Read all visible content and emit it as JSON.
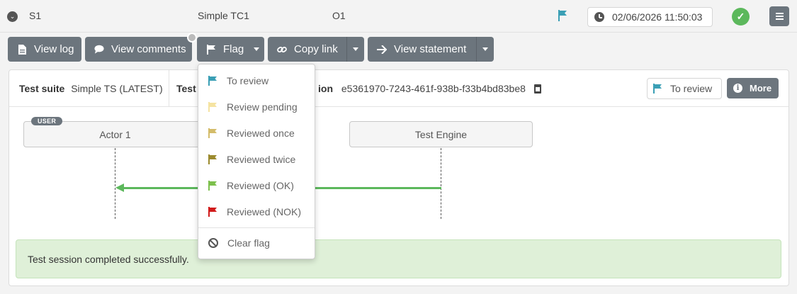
{
  "header": {
    "session_id": "S1",
    "test_case": "Simple TC1",
    "outcome": "O1",
    "flag_color": "#3a9fb5",
    "date": "02/06/2026 11:50:03",
    "status_color": "#5cb85c"
  },
  "toolbar": {
    "view_log": "View log",
    "view_comments": "View comments",
    "flag": "Flag",
    "copy_link": "Copy link",
    "view_statement": "View statement"
  },
  "details": {
    "test_suite_label": "Test suite",
    "test_suite_value": "Simple TS (LATEST)",
    "test_label_partial": "Test",
    "session_label_partial": "ion",
    "session_value": "e5361970-7243-461f-938b-f33b4bd83be8",
    "to_review_label": "To review",
    "more_label": "More"
  },
  "diagram": {
    "user_badge": "USER",
    "actor1": "Actor 1",
    "actor2": "Test Engine",
    "arrow_color": "#5cb85c"
  },
  "success_message": "Test session completed successfully.",
  "flag_menu": {
    "items": [
      {
        "label": "To review",
        "color": "#3a9fb5"
      },
      {
        "label": "Review pending",
        "color": "#f5e3a1"
      },
      {
        "label": "Reviewed once",
        "color": "#d4bc6a"
      },
      {
        "label": "Reviewed twice",
        "color": "#9b8a2e"
      },
      {
        "label": "Reviewed (OK)",
        "color": "#7cc04c"
      },
      {
        "label": "Reviewed (NOK)",
        "color": "#d11a1a"
      }
    ],
    "clear_label": "Clear flag"
  }
}
